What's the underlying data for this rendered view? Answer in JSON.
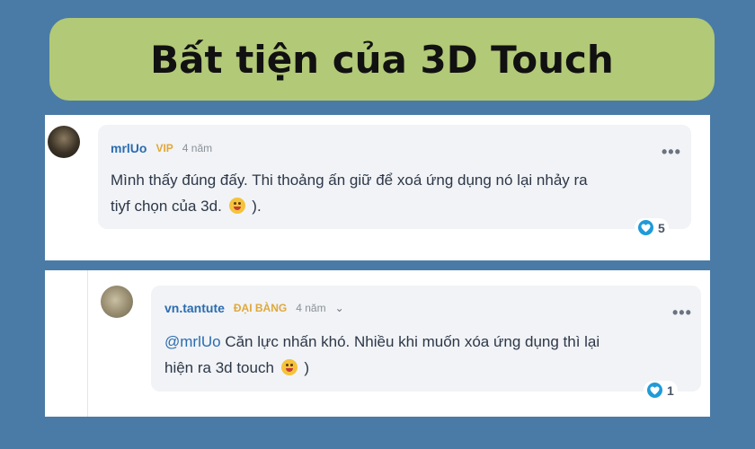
{
  "banner": {
    "title": "Bất tiện của 3D Touch"
  },
  "comments": [
    {
      "author": "mrlUo",
      "badge": "VIP",
      "time": "4 năm",
      "more": "•••",
      "text_line1": "Mình thấy đúng đấy. Thi thoảng ấn giữ để xoá ứng dụng nó lại nhảy ra",
      "text_line2_before": "tiyf chọn của 3d.",
      "text_line2_after": ").",
      "reaction_count": "5",
      "colors": {
        "author": "#2b6cb0",
        "badge": "#e0a83a"
      }
    },
    {
      "author": "vn.tantute",
      "badge": "ĐẠI BÀNG",
      "time": "4 năm",
      "chevron": "⌄",
      "more": "•••",
      "mention": "@mrlUo",
      "text_line1_rest": " Căn lực nhấn khó. Nhiều khi muốn xóa ứng dụng thì lại",
      "text_line2_before": "hiện ra 3d touch",
      "text_line2_after": ")",
      "reaction_count": "1",
      "colors": {
        "author": "#2b6cb0",
        "badge": "#e0a83a"
      }
    }
  ],
  "colors": {
    "background": "#4a7ba6",
    "banner": "#b2c977",
    "bubble": "#f1f3f6",
    "reaction": "#1f9bd8"
  }
}
